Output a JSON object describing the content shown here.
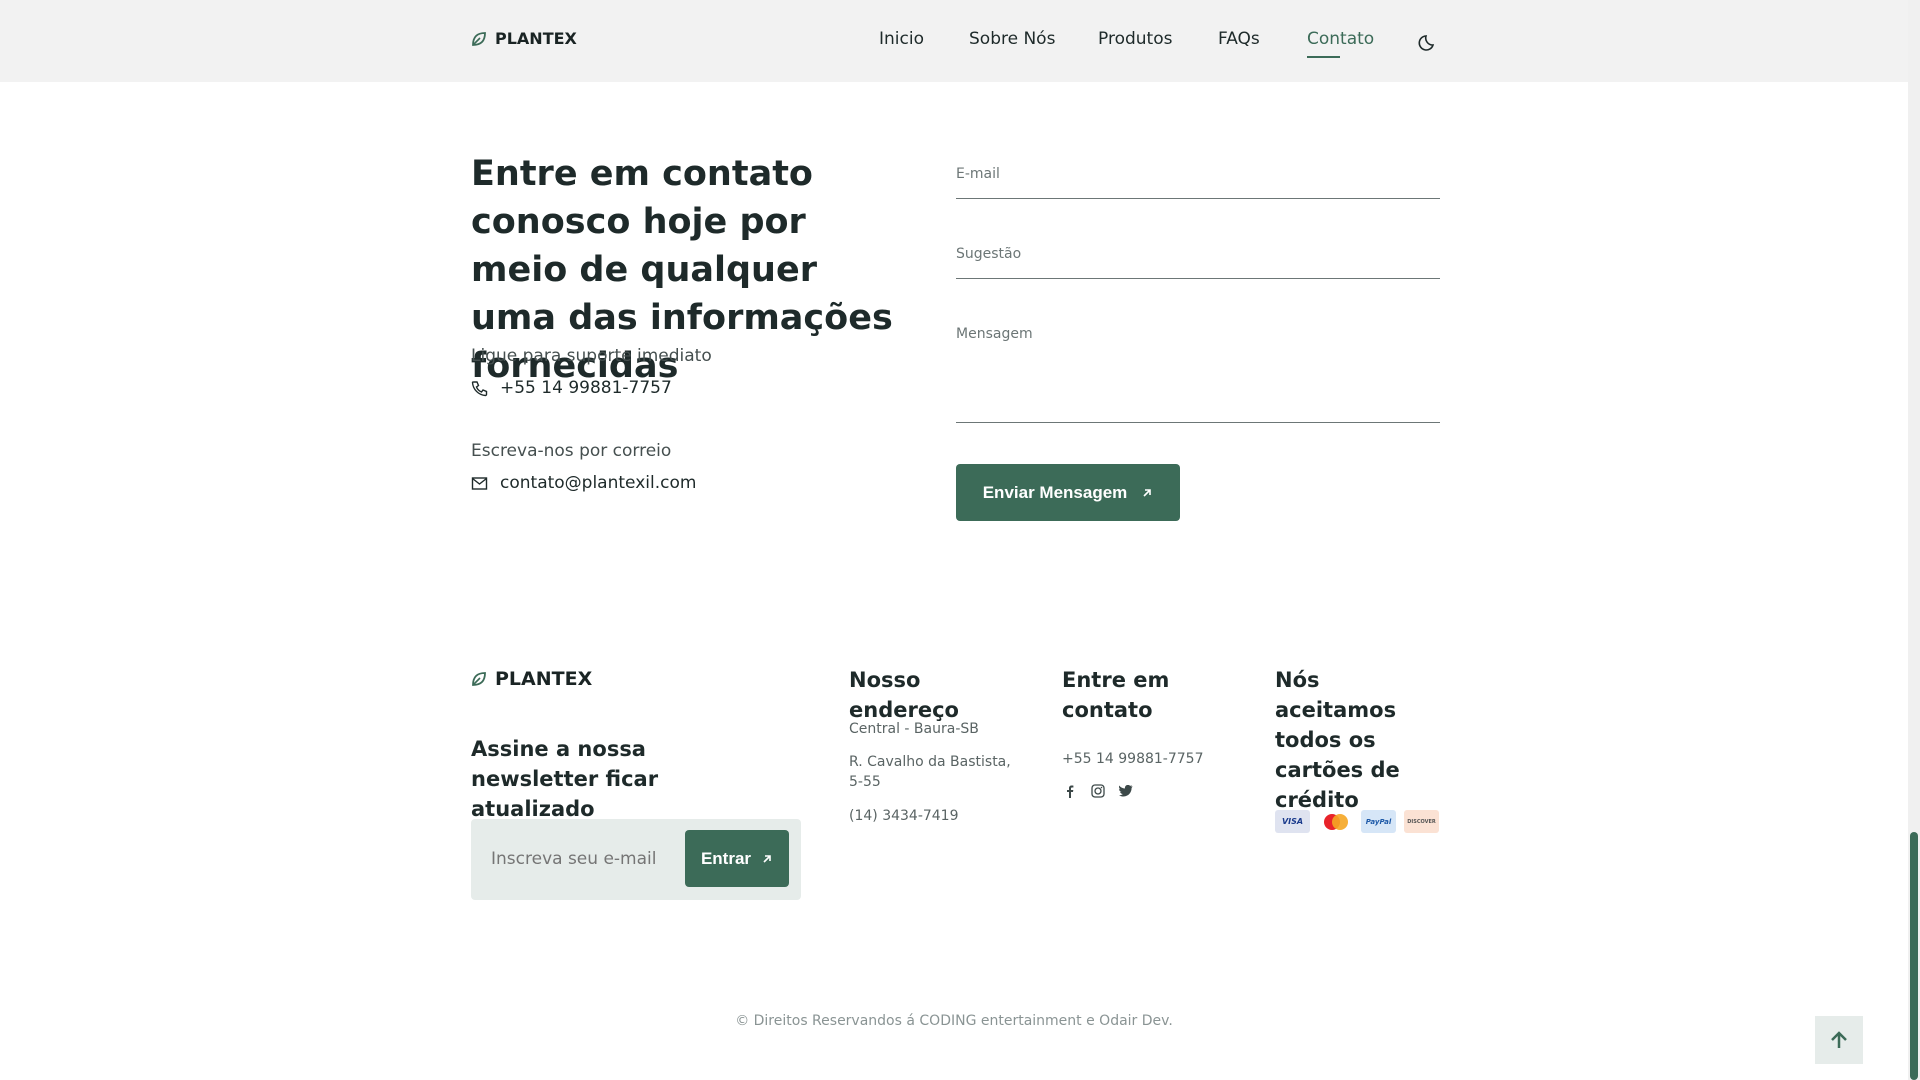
{
  "brand": {
    "name": "PLANTEX"
  },
  "nav": {
    "items": [
      {
        "label": "Inicio"
      },
      {
        "label": "Sobre Nós"
      },
      {
        "label": "Produtos"
      },
      {
        "label": "FAQs"
      },
      {
        "label": "Contato"
      }
    ],
    "active": "Contato"
  },
  "contact": {
    "title": "Entre em contato conosco hoje por meio de qualquer uma das informações fornecidas",
    "phone_label": "Ligue para suporte imediato",
    "phone": "+55 14 99881-7757",
    "email_label": "Escreva-nos por correio",
    "email": "contato@plantexil.com"
  },
  "form": {
    "email_placeholder": "E-mail",
    "subject_placeholder": "Sugestão",
    "message_placeholder": "Mensagem",
    "submit_label": "Enviar Mensagem"
  },
  "footer": {
    "newsletter_title": "Assine a nossa newsletter ficar atualizado",
    "newsletter_placeholder": "Inscreva seu e-mail",
    "newsletter_button": "Entrar",
    "address_title": "Nosso endereço",
    "address_lines": [
      "Central - Baura-SB",
      "R. Cavalho da Bastista, 5-55",
      "(14) 3434-7419"
    ],
    "contact_title": "Entre em contato",
    "contact_phone": "+55 14 99881-7757",
    "social": [
      "facebook-icon",
      "instagram-icon",
      "twitter-icon"
    ],
    "cards_title": "Nós aceitamos todos os cartões de crédito",
    "cards": [
      "VISA",
      "mastercard",
      "PayPal",
      "DISCOVER"
    ],
    "copyright": "© Direitos Reservandos á CODING entertainment e Odair Dev."
  },
  "colors": {
    "accent": "#3c6b58",
    "header_bg": "#f2f2f2",
    "panel_bg": "#e6ecea",
    "text": "#1e2a2a"
  }
}
